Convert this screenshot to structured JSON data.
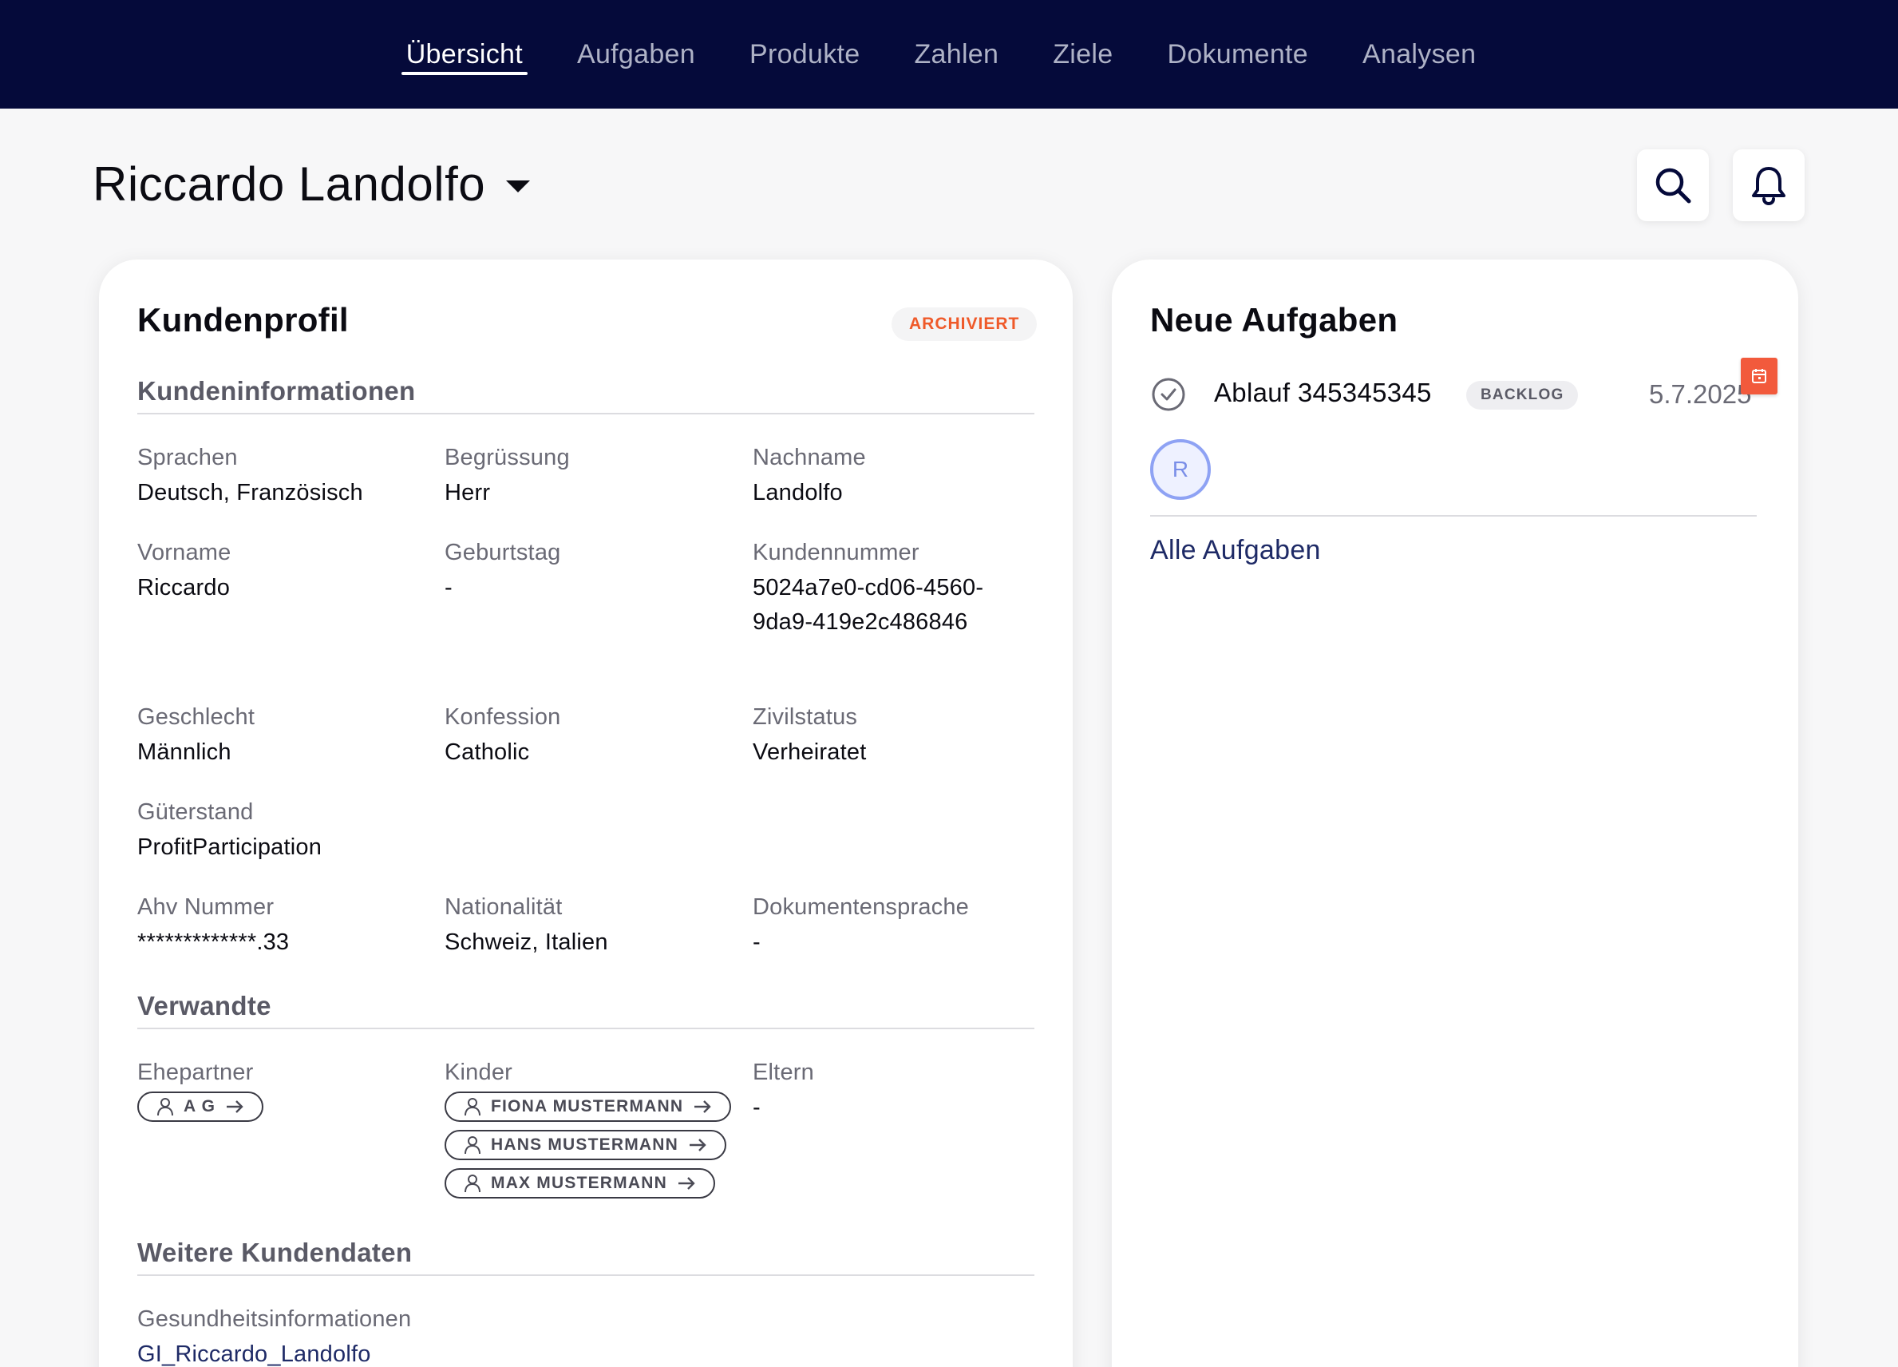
{
  "nav": {
    "tabs": [
      {
        "label": "Übersicht",
        "active": true
      },
      {
        "label": "Aufgaben"
      },
      {
        "label": "Produkte"
      },
      {
        "label": "Zahlen"
      },
      {
        "label": "Ziele"
      },
      {
        "label": "Dokumente"
      },
      {
        "label": "Analysen"
      }
    ]
  },
  "header": {
    "client_name": "Riccardo Landolfo",
    "icons": [
      "search-icon",
      "bell-icon"
    ]
  },
  "profile": {
    "title": "Kundenprofil",
    "status_badge": "ARCHIVIERT",
    "status_color": "#ef5a2a",
    "sections": {
      "info_title": "Kundeninformationen",
      "relatives_title": "Verwandte",
      "more_title": "Weitere Kundendaten"
    },
    "fields": {
      "sprachen": {
        "label": "Sprachen",
        "value": "Deutsch, Französisch"
      },
      "begruessung": {
        "label": "Begrüssung",
        "value": "Herr"
      },
      "nachname": {
        "label": "Nachname",
        "value": "Landolfo"
      },
      "vorname": {
        "label": "Vorname",
        "value": "Riccardo"
      },
      "geburtstag": {
        "label": "Geburtstag",
        "value": "-"
      },
      "kundennummer": {
        "label": "Kundennummer",
        "value": "5024a7e0-cd06-4560-9da9-419e2c486846"
      },
      "geschlecht": {
        "label": "Geschlecht",
        "value": "Männlich"
      },
      "konfession": {
        "label": "Konfession",
        "value": "Catholic"
      },
      "zivilstatus": {
        "label": "Zivilstatus",
        "value": "Verheiratet"
      },
      "gueterstand": {
        "label": "Güterstand",
        "value": "ProfitParticipation"
      },
      "ahv": {
        "label": "Ahv Nummer",
        "value": "*************.33"
      },
      "nationalitaet": {
        "label": "Nationalität",
        "value": "Schweiz, Italien"
      },
      "dokumentensprache": {
        "label": "Dokumentensprache",
        "value": "-"
      }
    },
    "relatives": {
      "ehepartner": {
        "label": "Ehepartner",
        "chips": [
          "A G"
        ]
      },
      "kinder": {
        "label": "Kinder",
        "chips": [
          "FIONA MUSTERMANN",
          "HANS MUSTERMANN",
          "MAX MUSTERMANN"
        ]
      },
      "eltern": {
        "label": "Eltern",
        "value": "-"
      }
    },
    "more": {
      "gesundheit": {
        "label": "Gesundheitsinformationen",
        "value": "GI_Riccardo_Landolfo"
      }
    }
  },
  "tasks": {
    "title": "Neue Aufgaben",
    "items": [
      {
        "name": "Ablauf 345345345",
        "status": "BACKLOG",
        "date": "5.7.2025",
        "assignee_initial": "R",
        "flag_color": "#f25a3c"
      }
    ],
    "all_link": "Alle Aufgaben"
  }
}
